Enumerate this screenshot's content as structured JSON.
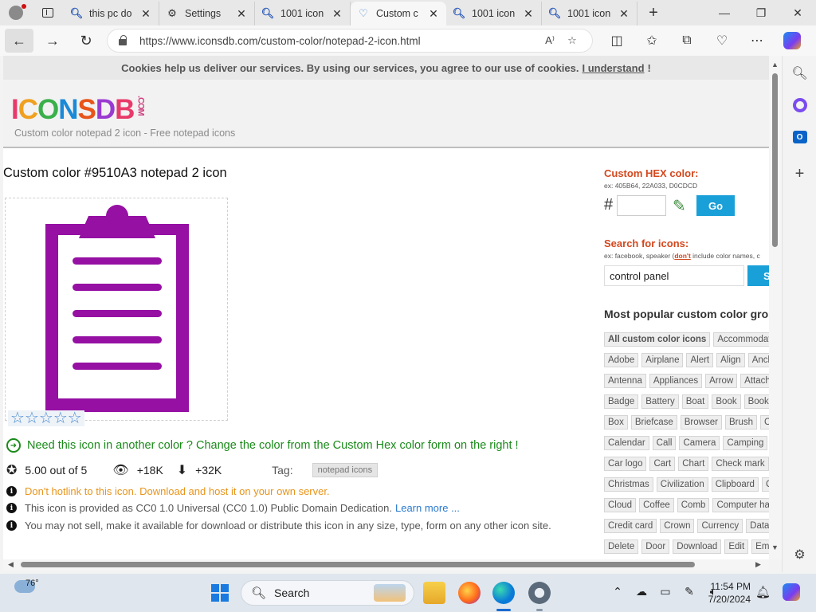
{
  "browser": {
    "tabs": [
      {
        "label": "this pc do",
        "icon": "search-icon"
      },
      {
        "label": "Settings",
        "icon": "gear-icon"
      },
      {
        "label": "1001 icon",
        "icon": "search-icon"
      },
      {
        "label": "Custom c",
        "icon": "heart-icon",
        "active": true
      },
      {
        "label": "1001 icon",
        "icon": "search-icon"
      },
      {
        "label": "1001 icon",
        "icon": "search-icon"
      }
    ],
    "url": "https://www.iconsdb.com/custom-color/notepad-2-icon.html"
  },
  "page": {
    "cookie_text": "Cookies help us deliver our services. By using our services, you agree to our use of cookies.",
    "cookie_link": "I understand",
    "cookie_bang": "!",
    "logo": {
      "letters": [
        "I",
        "C",
        "O",
        "N",
        "S",
        "D",
        "B"
      ],
      "colors": [
        "#e83a6a",
        "#f0a020",
        "#3ab04a",
        "#1a8ad8",
        "#e8541a",
        "#9a3ad0",
        "#e83a6a"
      ],
      "suffix": ".COM"
    },
    "tagline": "Custom color notepad 2 icon - Free notepad icons",
    "title": "Custom color #9510A3 notepad 2 icon",
    "icon_color": "#9510A3",
    "rating_stars_shown": 5,
    "need_color": "Need this icon in another color ? Change the color from the Custom Hex color form on the right !",
    "rating": "5.00 out of 5",
    "views": "+18K",
    "downloads": "+32K",
    "tag_label": "Tag:",
    "tag": "notepad icons",
    "notes": {
      "hotlink": "Don't hotlink to this icon. Download and host it on your own server.",
      "license": "This icon is provided as CC0 1.0 Universal (CC0 1.0) Public Domain Dedication.",
      "learn_more": "Learn more ...",
      "no_sell": "You may not sell, make it available for download or distribute this icon in any size, type, form on any other icon site."
    },
    "right": {
      "hex_heading": "Custom HEX color:",
      "hex_example": "ex: 405B64, 22A033, D0CDCD",
      "hash": "#",
      "hex_value": "",
      "go_label": "Go",
      "search_heading": "Search for icons:",
      "search_example_pre": "ex: facebook, speaker (",
      "search_example_dont": "don't",
      "search_example_post": " include color names, c",
      "search_value": "control panel",
      "search_btn": "S",
      "popular_heading": "Most popular custom color grou",
      "categories": [
        [
          "All custom color icons",
          "Accommodati"
        ],
        [
          "Adobe",
          "Airplane",
          "Alert",
          "Align",
          "Ancho"
        ],
        [
          "Antenna",
          "Appliances",
          "Arrow",
          "Attach"
        ],
        [
          "Badge",
          "Battery",
          "Boat",
          "Book",
          "Bookma"
        ],
        [
          "Box",
          "Briefcase",
          "Browser",
          "Brush",
          "Calc"
        ],
        [
          "Calendar",
          "Call",
          "Camera",
          "Camping",
          "C"
        ],
        [
          "Car logo",
          "Cart",
          "Chart",
          "Check mark",
          "("
        ],
        [
          "Christmas",
          "Civilization",
          "Clipboard",
          "Clo"
        ],
        [
          "Cloud",
          "Coffee",
          "Comb",
          "Computer hard"
        ],
        [
          "Credit card",
          "Crown",
          "Currency",
          "Databa"
        ],
        [
          "Delete",
          "Door",
          "Download",
          "Edit",
          "Emai"
        ]
      ]
    }
  },
  "taskbar": {
    "temperature": "76°",
    "search_placeholder": "Search",
    "time": "11:54 PM",
    "date": "7/20/2024"
  }
}
